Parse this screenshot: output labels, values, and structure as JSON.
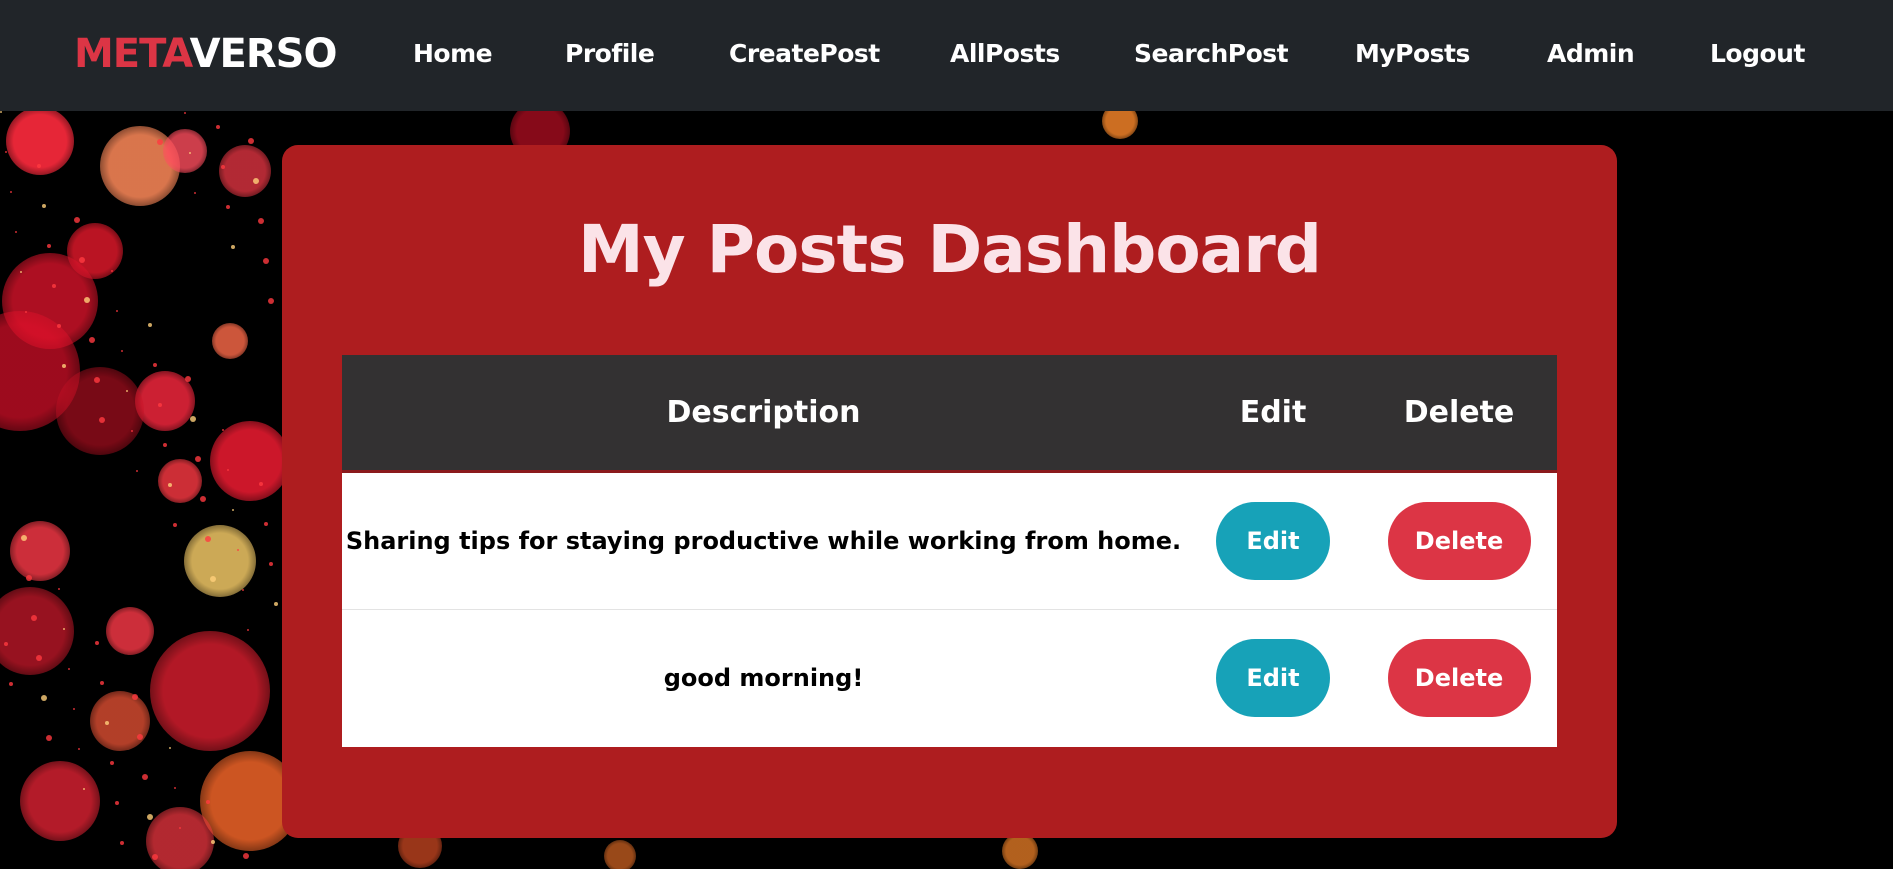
{
  "brand": {
    "part1": "META",
    "part2": "VERSO"
  },
  "nav": {
    "items": [
      "Home",
      "Profile",
      "CreatePost",
      "AllPosts",
      "SearchPost",
      "MyPosts",
      "Admin",
      "Logout"
    ]
  },
  "page": {
    "title": "My Posts Dashboard"
  },
  "table": {
    "headers": {
      "description": "Description",
      "edit": "Edit",
      "delete": "Delete"
    },
    "rows": [
      {
        "description": "Sharing tips for staying productive while working from home.",
        "edit_label": "Edit",
        "delete_label": "Delete"
      },
      {
        "description": "good morning!",
        "edit_label": "Edit",
        "delete_label": "Delete"
      }
    ]
  },
  "colors": {
    "navbar": "#212529",
    "brand_accent": "#dc3545",
    "card": "#ae1d1f",
    "table_header": "#333132",
    "edit_button": "#17a2b8",
    "delete_button": "#dc3545"
  }
}
